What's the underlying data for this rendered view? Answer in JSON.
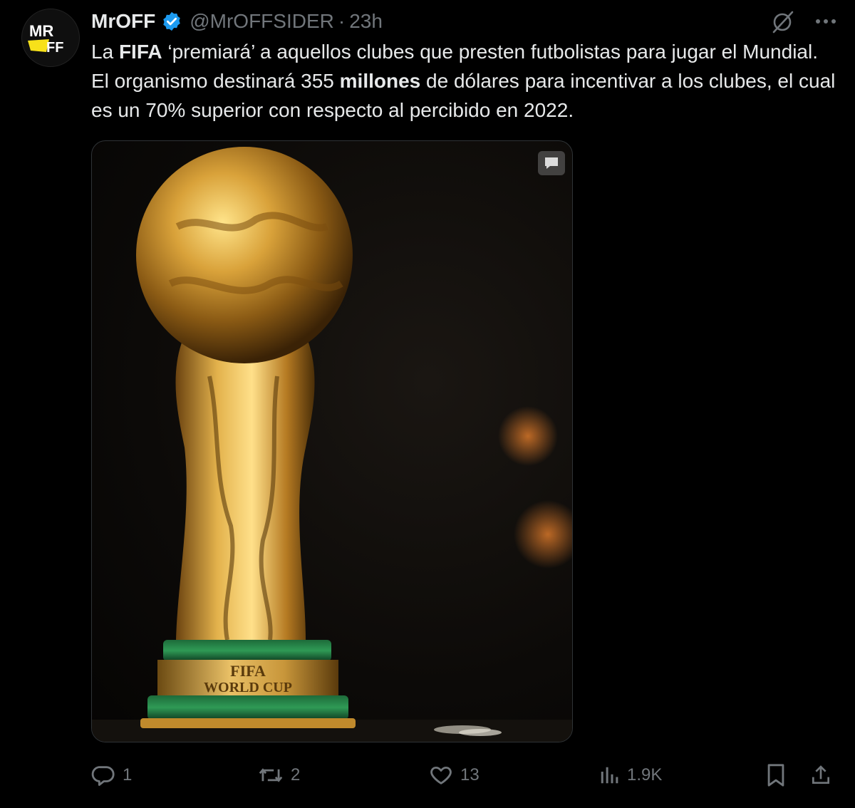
{
  "author": {
    "display_name": "MrOFF",
    "handle": "@MrOFFSIDER",
    "separator": "·",
    "time": "23h",
    "avatar_text_top": "MR",
    "avatar_text_bottom": "FF",
    "verified_icon": "verified-badge-icon"
  },
  "tweet": {
    "parts": [
      {
        "text": "La ",
        "bold": false
      },
      {
        "text": "FIFA",
        "bold": true
      },
      {
        "text": " ‘premiará’ a aquellos clubes que presten futbolistas para jugar el Mundial. El organismo destinará 355 ",
        "bold": false
      },
      {
        "text": "millones",
        "bold": true
      },
      {
        "text": " de dólares para incentivar a los clubes, el cual es un 70% superior con respecto al percibido en 2022.",
        "bold": false
      }
    ]
  },
  "media": {
    "trophy_base_line1": "FIFA",
    "trophy_base_line2": "WORLD CUP",
    "badge_icon": "alt-text-icon"
  },
  "actions": {
    "reply_count": "1",
    "repost_count": "2",
    "like_count": "13",
    "views_count": "1.9K"
  },
  "colors": {
    "background": "#000000",
    "text": "#e7e9ea",
    "muted": "#71767b",
    "verified": "#1d9bf0",
    "avatar_yellow": "#f7e11a"
  }
}
